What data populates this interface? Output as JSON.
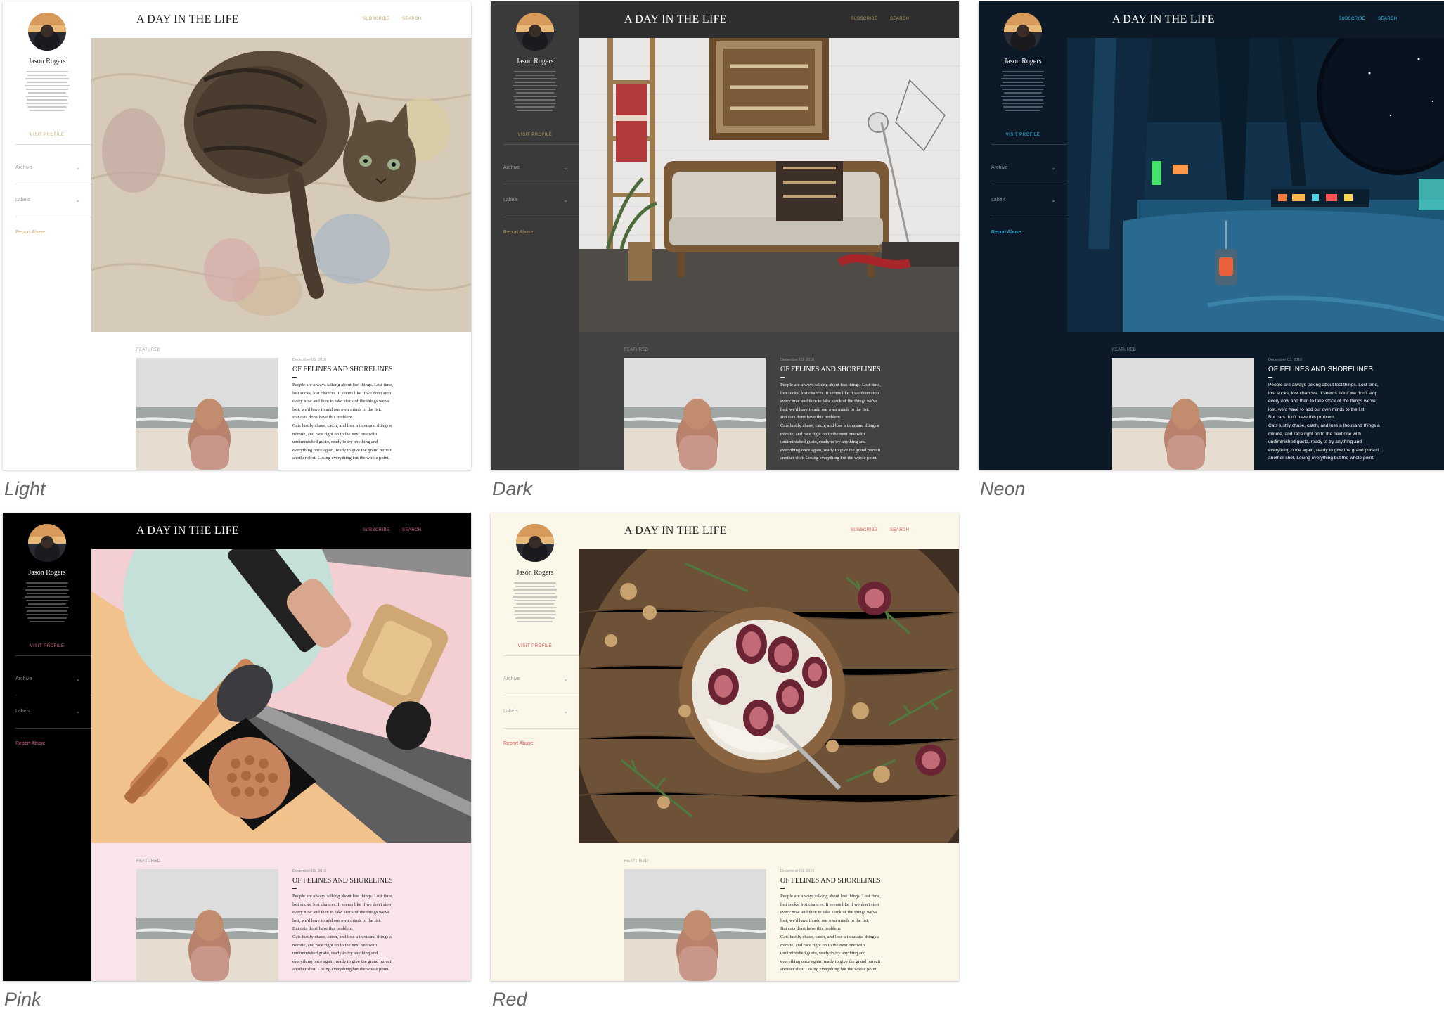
{
  "blog": {
    "author_name": "Jason Rogers",
    "visit_profile": "VISIT PROFILE",
    "archive_label": "Archive",
    "labels_label": "Labels",
    "report_abuse": "Report Abuse",
    "title": "A DAY IN THE LIFE",
    "subscribe": "SUBSCRIBE",
    "search": "SEARCH",
    "featured": "FEATURED",
    "post_date": "December 03, 2016",
    "post_title": "OF FELINES AND SHORELINES",
    "post_lines": [
      "People are always talking about lost things. Lost time,",
      "lost socks, lost chances. It seems like if we don't stop",
      "every now and then to take stock of the things we've",
      "lost, we'd have to add our own minds to the list.",
      "But cats don't have this problem.",
      "Cats lustily chase, catch, and lose a thousand things a",
      "minute, and race right on to the next one with",
      "undiminished gusto, ready to try anything and",
      "everything once again, ready to give the grand pursuit",
      "another shot. Losing everything but the whole point."
    ]
  },
  "themes": [
    {
      "id": "light",
      "caption": "Light",
      "side_bg": "#ffffff",
      "main_bg": "#ffffff",
      "hdr_bg": "#ffffff",
      "text": "#212121",
      "muted": "#9e9e9e",
      "accent": "#c8a86b",
      "divider": "#e0e0e0",
      "hero": "cat"
    },
    {
      "id": "dark",
      "caption": "Dark",
      "side_bg": "#3a3a3a",
      "main_bg": "#424242",
      "hdr_bg": "#2e2e2e",
      "text": "#ffffff",
      "muted": "#9a9a9a",
      "accent": "#b79d62",
      "divider": "#555555",
      "hero": "room"
    },
    {
      "id": "neon",
      "caption": "Neon",
      "side_bg": "#0b1a26",
      "main_bg": "#0b1a26",
      "hdr_bg": "#0b1a26",
      "text": "#ffffff",
      "muted": "#7f95a6",
      "accent": "#38c9ff",
      "divider": "#2a3d4b",
      "hero": "space"
    },
    {
      "id": "pink",
      "caption": "Pink",
      "side_bg": "#000000",
      "main_bg": "#f8e4ea",
      "hdr_bg": "#000000",
      "text": "#212121",
      "muted": "#8d8d8d",
      "accent": "#d0637f",
      "divider": "#333333",
      "hero": "cosmetics"
    },
    {
      "id": "red",
      "caption": "Red",
      "side_bg": "#fbf8ea",
      "main_bg": "#fbf8ea",
      "hdr_bg": "#fbf8ea",
      "text": "#212121",
      "muted": "#9e9e9e",
      "accent": "#d9534f",
      "divider": "#e4e0cc",
      "hero": "food"
    }
  ]
}
